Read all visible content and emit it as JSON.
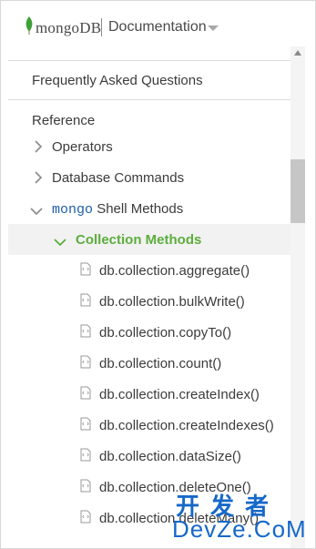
{
  "header": {
    "logo_text": "mongoDB",
    "doc_title": "Documentation",
    "leaf_color": "#3fa037"
  },
  "nav": {
    "faq_label": "Frequently Asked Questions",
    "reference_label": "Reference",
    "items": [
      {
        "label": "Operators",
        "icon": "chevron-right-icon"
      },
      {
        "label": "Database Commands",
        "icon": "chevron-right-icon"
      },
      {
        "label_mono": "mongo",
        "label": "Shell Methods",
        "icon": "chevron-down-icon"
      },
      {
        "label": "Collection Methods",
        "icon": "chevron-down-icon",
        "active": true,
        "active_color": "#5cad3c"
      }
    ],
    "methods": [
      "db.collection.aggregate()",
      "db.collection.bulkWrite()",
      "db.collection.copyTo()",
      "db.collection.count()",
      "db.collection.createIndex()",
      "db.collection.createIndexes()",
      "db.collection.dataSize()",
      "db.collection.deleteOne()",
      "db.collection.deleteMany()"
    ]
  },
  "watermark": {
    "line1": "开发者",
    "line2": "DevZe.CoM"
  }
}
